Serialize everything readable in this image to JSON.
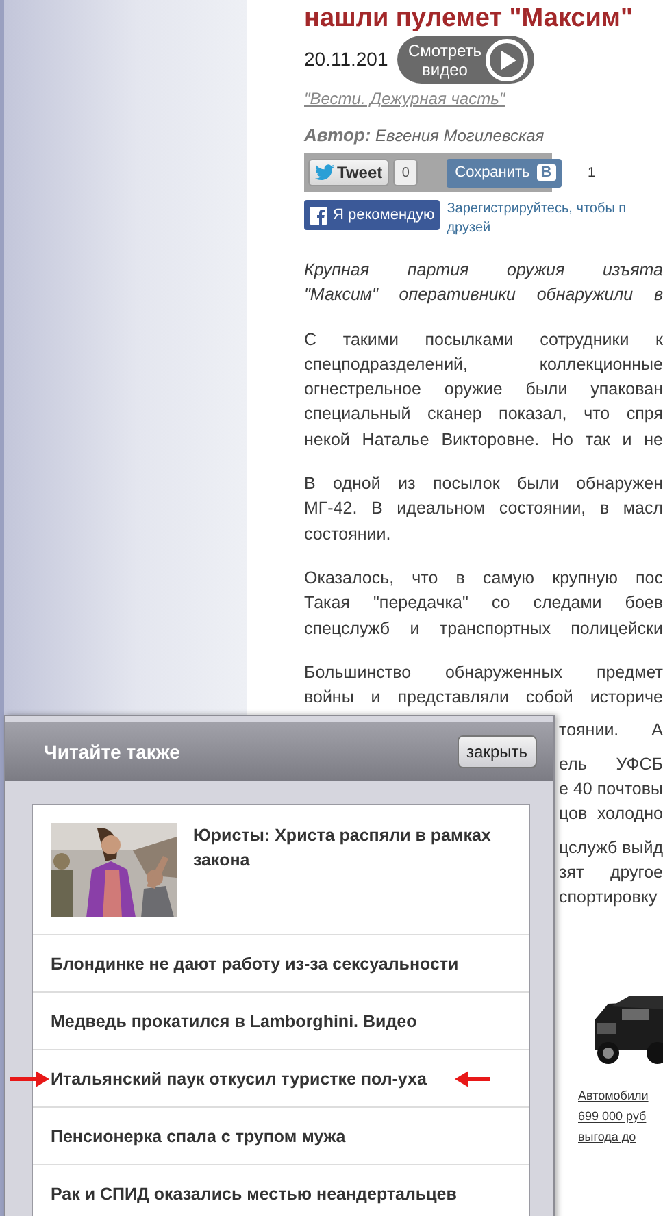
{
  "article": {
    "title": "нашли пулемет \"Максим\"",
    "date": "20.11.201",
    "source": "\"Вести. Дежурная часть\"",
    "author_label": "Автор:",
    "author": "Евгения Могилевская",
    "video_overlay": {
      "lines": [
        "Смотреть",
        "видео"
      ]
    },
    "share": {
      "tweet": "Tweet",
      "tweet_count": "0",
      "save": "Сохранить",
      "vk_letter": "В",
      "save_count": "1"
    },
    "facebook": {
      "button": "Я рекомендую",
      "note_lines": [
        "Зарегистрируйтесь, чтобы п",
        "друзей"
      ]
    },
    "paragraphs": [
      {
        "kind": "lead",
        "lines": [
          "Крупная партия оружия изъята",
          "\"Максим\" оперативники обнаружили в"
        ]
      },
      {
        "kind": "text",
        "lines": [
          "С такими посылками сотрудники к",
          "спецподразделений, коллекционные",
          "огнестрельное оружие были упакован",
          "специальный сканер показал, что спря",
          "некой Наталье Викторовне. Но так и не"
        ]
      },
      {
        "kind": "text",
        "lines": [
          "В одной из посылок были обнаружен",
          "МГ-42. В идеальном состоянии, в масл",
          "состоянии."
        ]
      },
      {
        "kind": "text",
        "lines": [
          "Оказалось, что в самую крупную пос",
          "Такая \"передачка\" со следами боев",
          "спецслужб и транспортных полицейски"
        ]
      },
      {
        "kind": "text",
        "lines": [
          "Большинство обнаруженных предмет",
          "войны и представляли собой историче"
        ]
      },
      {
        "kind": "fragment",
        "lines": [
          "тоянии. А"
        ]
      },
      {
        "kind": "fragment",
        "lines": [
          "ель УФСБ",
          "е 40 почтовы",
          "цов холодно"
        ]
      },
      {
        "kind": "fragment",
        "lines": [
          "цслужб выйд",
          "зят другое",
          "спортировку"
        ]
      }
    ],
    "ad": {
      "kind": "picture",
      "lines": [
        "Автомобили",
        "699 000 руб",
        "выгода до"
      ]
    }
  },
  "popup": {
    "title": "Читайте также",
    "close": "закрыть",
    "items": [
      {
        "kind": "picture",
        "title": "Юристы: Христа распяли в рамках закона",
        "marked": false
      },
      {
        "kind": "text",
        "title": "Блондинке не дают работу из-за сексуальности",
        "marked": false
      },
      {
        "kind": "text",
        "title": "Медведь прокатился в Lamborghini. Видео",
        "marked": false
      },
      {
        "kind": "text",
        "title": "Итальянский паук откусил туристке пол-уха",
        "marked": true
      },
      {
        "kind": "text",
        "title": "Пенсионерка спала с трупом мужа",
        "marked": false
      },
      {
        "kind": "text",
        "title": "Рак и СПИД оказались местью неандертальцев",
        "marked": false
      }
    ]
  }
}
